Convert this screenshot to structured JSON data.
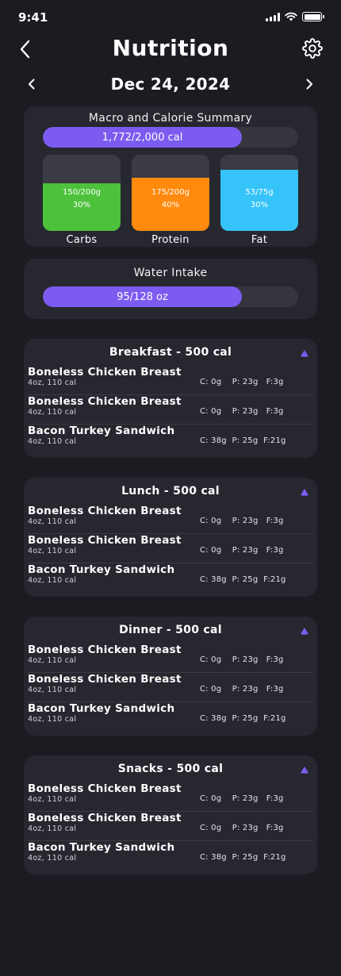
{
  "status": {
    "time": "9:41"
  },
  "header": {
    "title": "Nutrition"
  },
  "date_nav": {
    "date": "Dec 24, 2024"
  },
  "summary": {
    "title": "Macro and Calorie Summary",
    "calories_label": "1,772/2,000 cal",
    "calories_progress": 0.78,
    "macros": [
      {
        "label": "Carbs",
        "amount": "150/200g",
        "percent": "30%",
        "fill_fraction": 0.63,
        "color": "#4dc13c"
      },
      {
        "label": "Protein",
        "amount": "175/200g",
        "percent": "40%",
        "fill_fraction": 0.7,
        "color": "#ff8a0d"
      },
      {
        "label": "Fat",
        "amount": "53/75g",
        "percent": "30%",
        "fill_fraction": 0.8,
        "color": "#35c3f9"
      }
    ]
  },
  "water": {
    "title": "Water Intake",
    "label": "95/128 oz",
    "progress": 0.78
  },
  "meals": [
    {
      "title": "Breakfast - 500 cal",
      "items": [
        {
          "name": "Boneless Chicken Breast",
          "portion": "4oz, 110 cal",
          "macros": "C: 0g    P: 23g   F:3g"
        },
        {
          "name": "Boneless Chicken Breast",
          "portion": "4oz, 110 cal",
          "macros": "C: 0g    P: 23g   F:3g"
        },
        {
          "name": "Bacon Turkey Sandwich",
          "portion": "4oz, 110 cal",
          "macros": "C: 38g  P: 25g  F:21g"
        }
      ]
    },
    {
      "title": "Lunch - 500 cal",
      "items": [
        {
          "name": "Boneless Chicken Breast",
          "portion": "4oz, 110 cal",
          "macros": "C: 0g    P: 23g   F:3g"
        },
        {
          "name": "Boneless Chicken Breast",
          "portion": "4oz, 110 cal",
          "macros": "C: 0g    P: 23g   F:3g"
        },
        {
          "name": "Bacon Turkey Sandwich",
          "portion": "4oz, 110 cal",
          "macros": "C: 38g  P: 25g  F:21g"
        }
      ]
    },
    {
      "title": "Dinner - 500 cal",
      "items": [
        {
          "name": "Boneless Chicken Breast",
          "portion": "4oz, 110 cal",
          "macros": "C: 0g    P: 23g   F:3g"
        },
        {
          "name": "Boneless Chicken Breast",
          "portion": "4oz, 110 cal",
          "macros": "C: 0g    P: 23g   F:3g"
        },
        {
          "name": "Bacon Turkey Sandwich",
          "portion": "4oz, 110 cal",
          "macros": "C: 38g  P: 25g  F:21g"
        }
      ]
    },
    {
      "title": "Snacks - 500 cal",
      "items": [
        {
          "name": "Boneless Chicken Breast",
          "portion": "4oz, 110 cal",
          "macros": "C: 0g    P: 23g   F:3g"
        },
        {
          "name": "Boneless Chicken Breast",
          "portion": "4oz, 110 cal",
          "macros": "C: 0g    P: 23g   F:3g"
        },
        {
          "name": "Bacon Turkey Sandwich",
          "portion": "4oz, 110 cal",
          "macros": "C: 38g  P: 25g  F:21g"
        }
      ]
    }
  ],
  "colors": {
    "accent": "#7c5cf0",
    "background": "#1b1c22",
    "card": "#26272f"
  },
  "icons": {
    "back": "chevron-left-icon",
    "settings": "gear-icon",
    "prev": "chevron-left-icon",
    "next": "chevron-right-icon",
    "collapse": "triangle-up-icon"
  }
}
